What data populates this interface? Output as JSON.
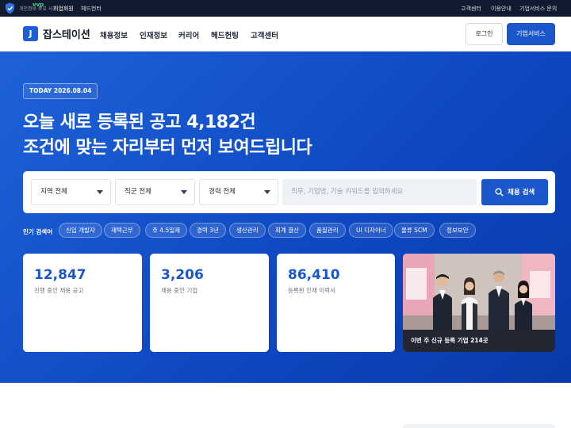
{
  "topbar": {
    "brand_mini": "개인정보 보호 사용",
    "brand_badge": "vvp",
    "left_links": [
      "기업회원",
      "헤드헌터"
    ],
    "right_links": [
      "고객센터",
      "이용안내",
      "기업서비스 문의"
    ]
  },
  "header": {
    "logo_letter": "J",
    "logo_text": "잡스테이션",
    "nav": [
      "채용정보",
      "인재정보",
      "커리어",
      "헤드헌팅",
      "고객센터"
    ],
    "login_label": "로그인",
    "biz_label": "기업서비스"
  },
  "hero": {
    "today_badge": "TODAY 2026.08.04",
    "headline_line1": "오늘 새로 등록된 공고 4,182건",
    "headline_line2": "조건에 맞는 자리부터 먼저 보여드립니다"
  },
  "search": {
    "region": "지역 전체",
    "job": "직군 전체",
    "career": "경력 전체",
    "keyword_placeholder": "직무, 기업명, 기술 키워드를 입력하세요",
    "button_label": "채용 검색"
  },
  "popular": {
    "label": "인기 검색어",
    "chips": [
      "신입 개발자",
      "재택근무",
      "주 4.5일제",
      "경력 3년",
      "생산관리",
      "회계 결산",
      "품질관리",
      "UI 디자이너",
      "물류 SCM",
      "정보보안"
    ]
  },
  "stats": [
    {
      "value": "12,847",
      "label": "진행 중인 채용 공고"
    },
    {
      "value": "3,206",
      "label": "채용 중인 기업"
    },
    {
      "value": "86,410",
      "label": "등록된 인재 이력서"
    }
  ],
  "photo_card": {
    "caption": "이번 주 신규 등록 기업 214곳"
  },
  "colors": {
    "primary": "#1a56cc",
    "hero_bg": "#0d47c1",
    "topbar_bg": "#111a2e"
  }
}
